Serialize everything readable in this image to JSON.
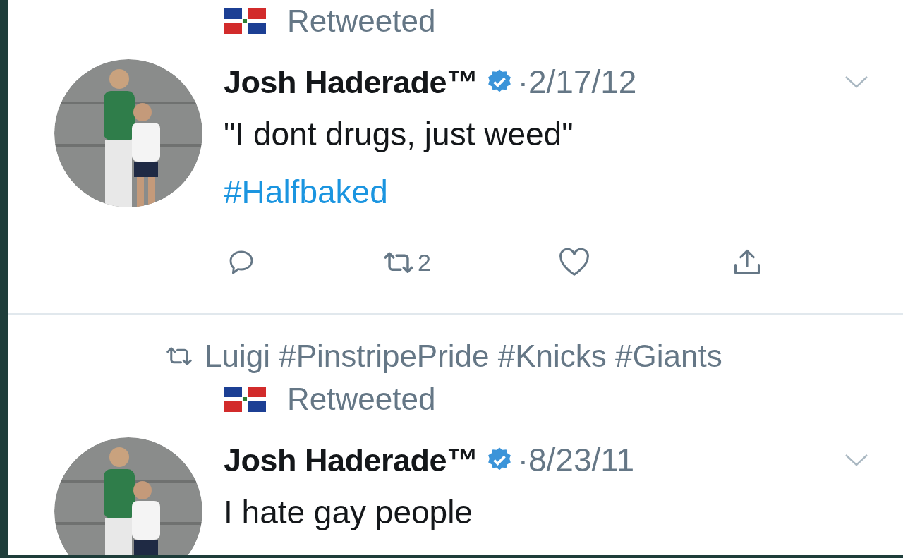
{
  "tweets": [
    {
      "context_label": "Retweeted",
      "author": "Josh Haderade™",
      "verified": true,
      "separator": "·",
      "date": "2/17/12",
      "text": "\"I dont drugs, just weed\"",
      "hashtag": "#Halfbaked",
      "actions": {
        "retweet_count": "2"
      }
    },
    {
      "retweeted_by": "Luigi #PinstripePride #Knicks #Giants",
      "context_label": "Retweeted",
      "author": "Josh Haderade™",
      "verified": true,
      "separator": "·",
      "date": "8/23/11",
      "text": "I hate gay people"
    }
  ]
}
